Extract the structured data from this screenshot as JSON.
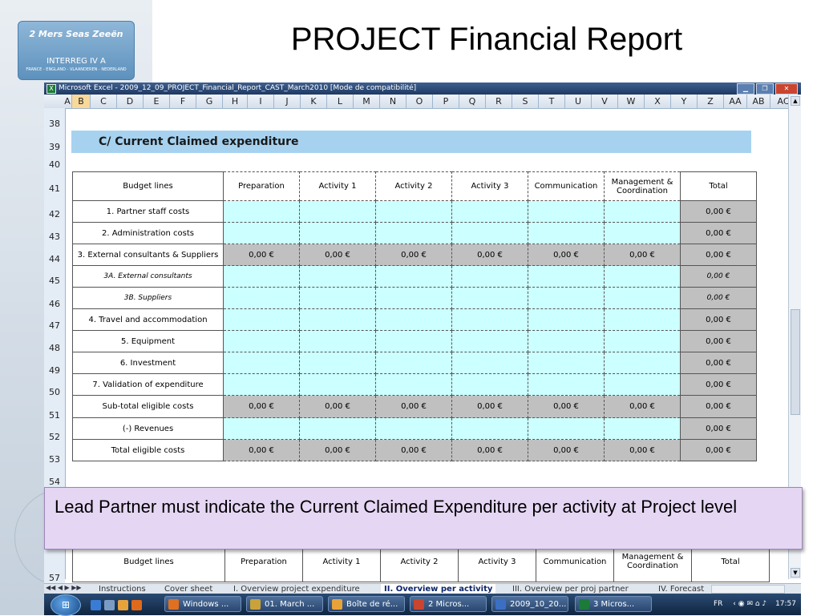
{
  "slide": {
    "title": "PROJECT Financial Report",
    "logo": {
      "line1": "2 Mers Seas Zeeën",
      "line2": "INTERREG IV A",
      "line3": "FRANCE - ENGLAND - VLAANDEREN - NEDERLAND"
    }
  },
  "excel": {
    "window_title": "Microsoft Excel - 2009_12_09_PROJECT_Financial_Report_CAST_March2010  [Mode de compatibilité]",
    "window_buttons": [
      "▁",
      "❐",
      "✕"
    ],
    "columns": [
      "A",
      "B",
      "C",
      "D",
      "E",
      "F",
      "G",
      "H",
      "I",
      "J",
      "K",
      "L",
      "M",
      "N",
      "O",
      "P",
      "Q",
      "R",
      "S",
      "T",
      "U",
      "V",
      "W",
      "X",
      "Y",
      "Z",
      "AA",
      "AB",
      "AC"
    ],
    "rows": [
      "38",
      "39",
      "40",
      "41",
      "42",
      "43",
      "44",
      "45",
      "46",
      "47",
      "48",
      "49",
      "50",
      "51",
      "52",
      "53",
      "54",
      "57"
    ],
    "section_title": "C/ Current Claimed expenditure",
    "table": {
      "headers": [
        "Budget lines",
        "Preparation",
        "Activity 1",
        "Activity 2",
        "Activity 3",
        "Communication",
        "Management & Coordination",
        "Total"
      ],
      "rows": [
        {
          "label": "1. Partner staff costs",
          "values": [
            "",
            "",
            "",
            "",
            "",
            ""
          ],
          "total": "0,00 €",
          "style": "cyan"
        },
        {
          "label": "2. Administration costs",
          "values": [
            "",
            "",
            "",
            "",
            "",
            ""
          ],
          "total": "0,00 €",
          "style": "cyan"
        },
        {
          "label": "3. External consultants & Suppliers",
          "values": [
            "0,00 €",
            "0,00 €",
            "0,00 €",
            "0,00 €",
            "0,00 €",
            "0,00 €"
          ],
          "total": "0,00 €",
          "style": "grey"
        },
        {
          "label": "3A. External consultants",
          "values": [
            "",
            "",
            "",
            "",
            "",
            ""
          ],
          "total": "0,00 €",
          "style": "cyan-italic"
        },
        {
          "label": "3B. Suppliers",
          "values": [
            "",
            "",
            "",
            "",
            "",
            ""
          ],
          "total": "0,00 €",
          "style": "cyan-italic"
        },
        {
          "label": "4. Travel and accommodation",
          "values": [
            "",
            "",
            "",
            "",
            "",
            ""
          ],
          "total": "0,00 €",
          "style": "cyan"
        },
        {
          "label": "5. Equipment",
          "values": [
            "",
            "",
            "",
            "",
            "",
            ""
          ],
          "total": "0,00 €",
          "style": "cyan"
        },
        {
          "label": "6. Investment",
          "values": [
            "",
            "",
            "",
            "",
            "",
            ""
          ],
          "total": "0,00 €",
          "style": "cyan"
        },
        {
          "label": "7. Validation of expenditure",
          "values": [
            "",
            "",
            "",
            "",
            "",
            ""
          ],
          "total": "0,00 €",
          "style": "cyan"
        },
        {
          "label": "Sub-total eligible costs",
          "values": [
            "0,00 €",
            "0,00 €",
            "0,00 €",
            "0,00 €",
            "0,00 €",
            "0,00 €"
          ],
          "total": "0,00 €",
          "style": "grey"
        },
        {
          "label": "(-) Revenues",
          "values": [
            "",
            "",
            "",
            "",
            "",
            ""
          ],
          "total": "0,00 €",
          "style": "cyan"
        },
        {
          "label": "Total eligible costs",
          "values": [
            "0,00 €",
            "0,00 €",
            "0,00 €",
            "0,00 €",
            "0,00 €",
            "0,00 €"
          ],
          "total": "0,00 €",
          "style": "grey"
        }
      ]
    },
    "sheet_tabs": [
      "Instructions",
      "Cover sheet",
      "I. Overview project expenditure",
      "II. Overview per activity",
      "III. Overview per proj partner",
      "IV. Forecast"
    ],
    "active_tab": "II. Overview per activity"
  },
  "callout": "Lead Partner must indicate the Current Claimed Expenditure per activity at Project level",
  "taskbar": {
    "buttons": [
      "Windows ...",
      "01. March ...",
      "Boîte de ré...",
      "2 Micros...",
      "2009_10_20...",
      "3 Micros..."
    ],
    "lang": "FR",
    "time": "17:57"
  }
}
